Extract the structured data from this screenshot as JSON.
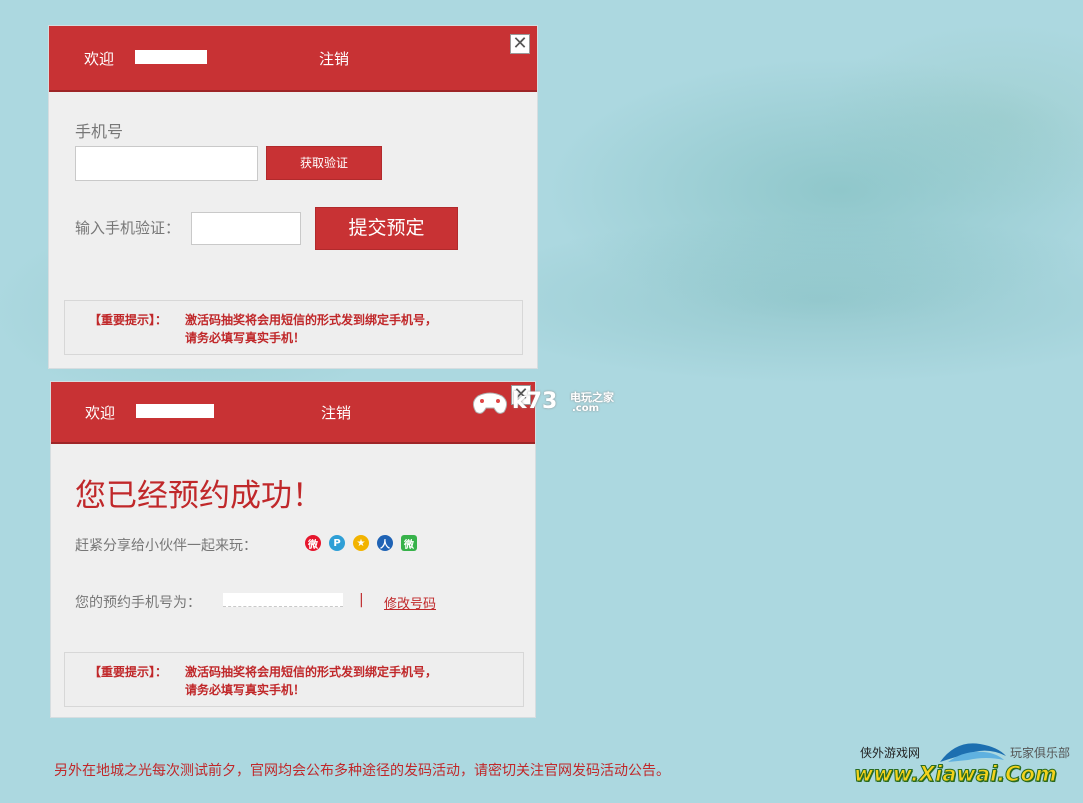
{
  "panel1": {
    "welcome": "欢迎",
    "logout": "注销",
    "close_symbol": "✕",
    "phone_label": "手机号",
    "get_code_label": "获取验证",
    "code_label": "输入手机验证：",
    "submit_label": "提交预定",
    "notice_tag": "【重要提示】：",
    "notice_line1": "激活码抽奖将会用短信的形式发到绑定手机号，",
    "notice_line2": "请务必填写真实手机！"
  },
  "panel2": {
    "welcome": "欢迎",
    "logout": "注销",
    "close_symbol": "✕",
    "success_title": "您已经预约成功！",
    "share_label": "赶紧分享给小伙伴一起来玩：",
    "share_icons": [
      "weibo-icon",
      "tencent-weibo-icon",
      "qzone-icon",
      "renren-icon",
      "wechat-icon"
    ],
    "phone_label": "您的预约手机号为：",
    "separator": "|",
    "modify_label": "修改号码",
    "notice_tag": "【重要提示】：",
    "notice_line1": "激活码抽奖将会用短信的形式发到绑定手机号，",
    "notice_line2": "请务必填写真实手机！"
  },
  "footer_text": "另外在地城之光每次测试前夕，官网均会公布多种途径的发码活动，请密切关注官网发码活动公告。",
  "watermark": {
    "k73": "k73",
    "k73_sub": "电玩之家",
    "k73_domain": ".com"
  },
  "logo": {
    "left_text": "侠外游戏网",
    "right_text": "玩家俱乐部",
    "url": "www.Xiawai.Com"
  },
  "colors": {
    "accent_red": "#c83234",
    "background": "#acd8e0",
    "panel_bg": "#efefef"
  }
}
